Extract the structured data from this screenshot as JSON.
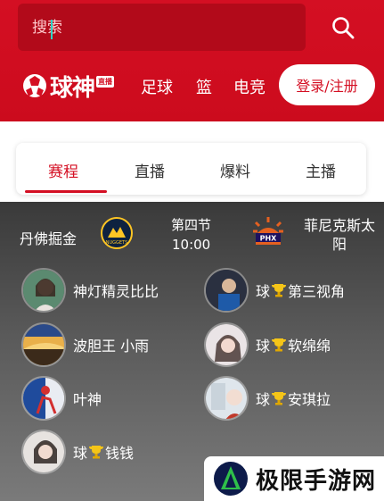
{
  "search": {
    "placeholder": "搜索"
  },
  "brand": {
    "name": "球神",
    "badge": "直播"
  },
  "nav": {
    "items": [
      "足球",
      "篮",
      "电竞"
    ],
    "login_label": "登录/注册"
  },
  "tabs": [
    "赛程",
    "直播",
    "爆料",
    "主播"
  ],
  "match": {
    "home": "丹佛掘金",
    "period": "第四节",
    "time": "10:00",
    "away": "菲尼克斯太阳",
    "home_logo_text": "NUGGETS",
    "away_logo_text": "PHX"
  },
  "anchors": [
    {
      "name": "神灯精灵比比"
    },
    {
      "prefix": "球",
      "name": "第三视角"
    },
    {
      "name": "波胆王 小雨"
    },
    {
      "prefix": "球",
      "name": "软绵绵"
    },
    {
      "name": "叶神"
    },
    {
      "prefix": "球",
      "name": "安琪拉"
    },
    {
      "prefix": "球",
      "name": "钱钱"
    }
  ],
  "watermark": {
    "text": "极限手游网"
  },
  "colors": {
    "brand_red": "#d40f23",
    "panel_dark": "#3a3a3a",
    "white": "#ffffff"
  },
  "icons": [
    "search-icon",
    "football-logo-icon",
    "nuggets-logo-icon",
    "suns-logo-icon",
    "trophy-icon",
    "watermark-logo-icon"
  ]
}
